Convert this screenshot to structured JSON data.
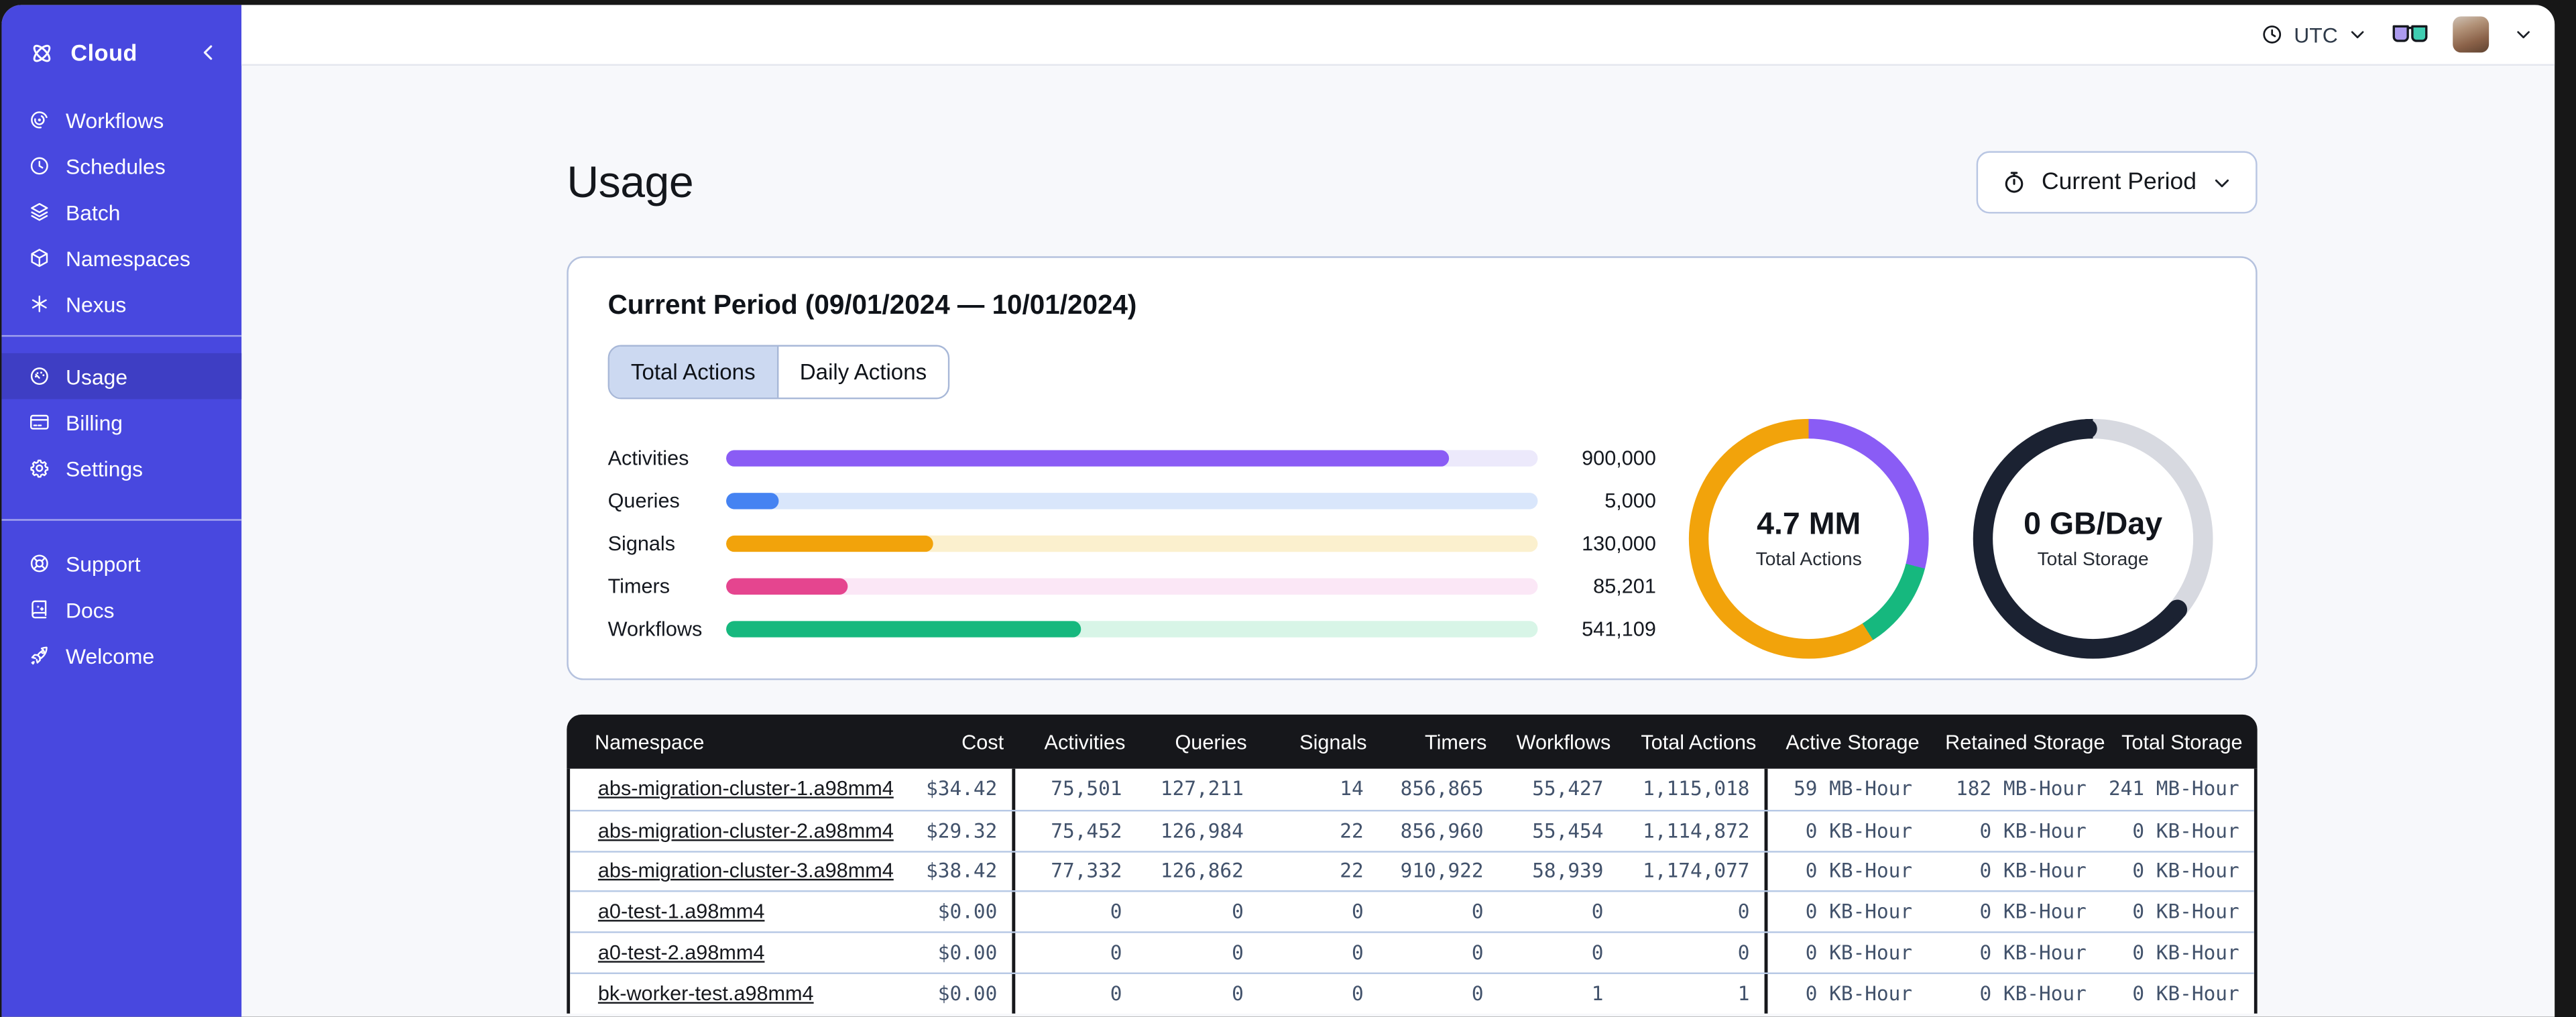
{
  "colors": {
    "sidebar_bg": "#4848DF",
    "sidebar_active": "#3E3EC4",
    "content_bg": "#F7F8FB",
    "card_border": "#B5C2DE",
    "table_header": "#16171B",
    "row_divider": "#B7C9E5"
  },
  "sidebar": {
    "product_label": "Cloud",
    "logo_icon": "temporal-logo-icon",
    "collapse_icon": "chevron-left-icon",
    "nav_primary": [
      {
        "label": "Workflows",
        "icon": "workflows-icon",
        "active": false
      },
      {
        "label": "Schedules",
        "icon": "schedules-icon",
        "active": false
      },
      {
        "label": "Batch",
        "icon": "batch-icon",
        "active": false
      },
      {
        "label": "Namespaces",
        "icon": "namespaces-icon",
        "active": false
      },
      {
        "label": "Nexus",
        "icon": "nexus-icon",
        "active": false
      }
    ],
    "nav_account": [
      {
        "label": "Usage",
        "icon": "usage-icon",
        "active": true
      },
      {
        "label": "Billing",
        "icon": "billing-icon",
        "active": false
      },
      {
        "label": "Settings",
        "icon": "settings-icon",
        "active": false
      }
    ],
    "nav_footer": [
      {
        "label": "Support",
        "icon": "support-icon",
        "active": false
      },
      {
        "label": "Docs",
        "icon": "docs-icon",
        "active": false
      },
      {
        "label": "Welcome",
        "icon": "welcome-icon",
        "active": false
      }
    ]
  },
  "topbar": {
    "timezone": "UTC",
    "timezone_icon": "clock-icon",
    "feedback_icon": "glasses-icon"
  },
  "page": {
    "title": "Usage",
    "period_selector_label": "Current Period",
    "period_selector_icon": "stopwatch-icon"
  },
  "usage_card": {
    "title": "Current Period (09/01/2024 — 10/01/2024)",
    "tabs": [
      {
        "label": "Total Actions",
        "active": true
      },
      {
        "label": "Daily Actions",
        "active": false
      }
    ]
  },
  "chart_data": [
    {
      "type": "bar",
      "orientation": "horizontal",
      "title": "Total Actions by type",
      "categories": [
        "Activities",
        "Queries",
        "Signals",
        "Timers",
        "Workflows"
      ],
      "values": [
        900000,
        5000,
        130000,
        85201,
        541109
      ],
      "display_values": [
        "900,000",
        "5,000",
        "130,000",
        "85,201",
        "541,109"
      ],
      "fill_percents": [
        89,
        6.4,
        25.5,
        15,
        43.7
      ],
      "bar_colors": [
        "#8A5CF5",
        "#4583F2",
        "#F2A30B",
        "#E5458F",
        "#16B87E"
      ],
      "track_colors": [
        "#ECE9FB",
        "#D9E6FB",
        "#FBF0CE",
        "#FBE7F6",
        "#D8F5E7"
      ]
    },
    {
      "type": "donut",
      "center_value": "4.7 MM",
      "center_label": "Total Actions",
      "segments": [
        {
          "color": "#8A5CF5",
          "percent": 29
        },
        {
          "color": "#16B87E",
          "percent": 12
        },
        {
          "color": "#F2A30B",
          "percent": 59
        }
      ],
      "rounded_caps": false
    },
    {
      "type": "donut",
      "center_value": "0 GB/Day",
      "center_label": "Total Storage",
      "segments": [
        {
          "color": "#D7D9E0",
          "percent": 36
        },
        {
          "color": "#1B2232",
          "percent": 64
        }
      ],
      "rounded_caps": true,
      "cap_color": "#1B2232",
      "cap_angles": [
        -3,
        130
      ]
    }
  ],
  "table": {
    "columns": [
      {
        "key": "namespace",
        "label": "Namespace",
        "group_end": false
      },
      {
        "key": "cost",
        "label": "Cost",
        "group_end": true
      },
      {
        "key": "activities",
        "label": "Activities",
        "group_end": false
      },
      {
        "key": "queries",
        "label": "Queries",
        "group_end": false
      },
      {
        "key": "signals",
        "label": "Signals",
        "group_end": false
      },
      {
        "key": "timers",
        "label": "Timers",
        "group_end": false
      },
      {
        "key": "workflows",
        "label": "Workflows",
        "group_end": false
      },
      {
        "key": "total_actions",
        "label": "Total Actions",
        "group_end": true
      },
      {
        "key": "active_storage",
        "label": "Active Storage",
        "group_end": false
      },
      {
        "key": "retained_storage",
        "label": "Retained Storage",
        "group_end": false
      },
      {
        "key": "total_storage",
        "label": "Total Storage",
        "group_end": false
      }
    ],
    "rows": [
      {
        "namespace": "abs-migration-cluster-1.a98mm4",
        "cost": "$34.42",
        "activities": "75,501",
        "queries": "127,211",
        "signals": "14",
        "timers": "856,865",
        "workflows": "55,427",
        "total_actions": "1,115,018",
        "active_storage": "59 MB-Hour",
        "retained_storage": "182 MB-Hour",
        "total_storage": "241 MB-Hour"
      },
      {
        "namespace": "abs-migration-cluster-2.a98mm4",
        "cost": "$29.32",
        "activities": "75,452",
        "queries": "126,984",
        "signals": "22",
        "timers": "856,960",
        "workflows": "55,454",
        "total_actions": "1,114,872",
        "active_storage": "0 KB-Hour",
        "retained_storage": "0 KB-Hour",
        "total_storage": "0 KB-Hour"
      },
      {
        "namespace": "abs-migration-cluster-3.a98mm4",
        "cost": "$38.42",
        "activities": "77,332",
        "queries": "126,862",
        "signals": "22",
        "timers": "910,922",
        "workflows": "58,939",
        "total_actions": "1,174,077",
        "active_storage": "0 KB-Hour",
        "retained_storage": "0 KB-Hour",
        "total_storage": "0 KB-Hour"
      },
      {
        "namespace": "a0-test-1.a98mm4",
        "cost": "$0.00",
        "activities": "0",
        "queries": "0",
        "signals": "0",
        "timers": "0",
        "workflows": "0",
        "total_actions": "0",
        "active_storage": "0 KB-Hour",
        "retained_storage": "0 KB-Hour",
        "total_storage": "0 KB-Hour"
      },
      {
        "namespace": "a0-test-2.a98mm4",
        "cost": "$0.00",
        "activities": "0",
        "queries": "0",
        "signals": "0",
        "timers": "0",
        "workflows": "0",
        "total_actions": "0",
        "active_storage": "0 KB-Hour",
        "retained_storage": "0 KB-Hour",
        "total_storage": "0 KB-Hour"
      },
      {
        "namespace": "bk-worker-test.a98mm4",
        "cost": "$0.00",
        "activities": "0",
        "queries": "0",
        "signals": "0",
        "timers": "0",
        "workflows": "1",
        "total_actions": "1",
        "active_storage": "0 KB-Hour",
        "retained_storage": "0 KB-Hour",
        "total_storage": "0 KB-Hour"
      }
    ]
  }
}
